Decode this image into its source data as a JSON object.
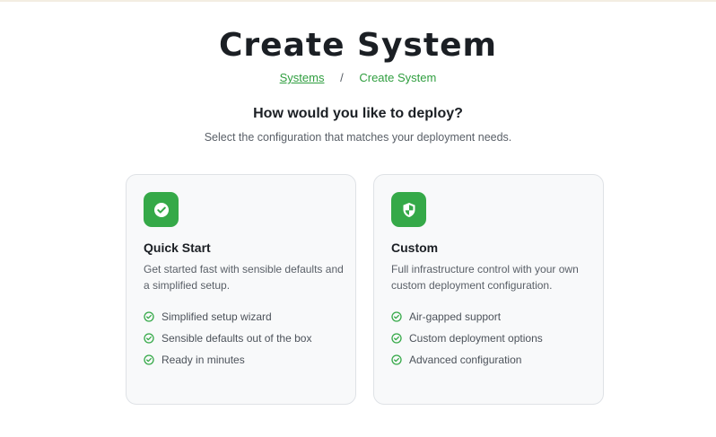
{
  "page": {
    "title": "Create System"
  },
  "breadcrumb": {
    "parent": "Systems",
    "separator": "/",
    "current": "Create System"
  },
  "prompt": {
    "heading": "How would you like to deploy?",
    "subheading": "Select the configuration that matches your deployment needs."
  },
  "options": [
    {
      "icon": "check-circle-icon",
      "title": "Quick Start",
      "description": "Get started fast with sensible defaults and a simplified setup.",
      "features": [
        "Simplified setup wizard",
        "Sensible defaults out of the box",
        "Ready in minutes"
      ]
    },
    {
      "icon": "shield-icon",
      "title": "Custom",
      "description": "Full infrastructure control with your own custom deployment configuration.",
      "features": [
        "Air-gapped support",
        "Custom deployment options",
        "Advanced configuration"
      ]
    }
  ],
  "colors": {
    "accent": "#35a948",
    "link": "#2f9e3f"
  }
}
